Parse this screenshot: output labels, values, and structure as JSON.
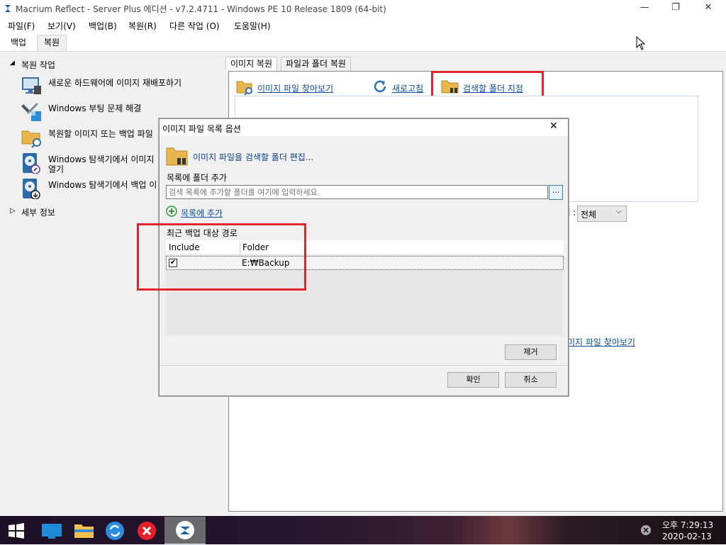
{
  "window": {
    "title": "Macrium Reflect - Server Plus 에디션 - v7.2.4711 - Windows PE 10 Release 1809 (64-bit)",
    "minimize_glyph": "—",
    "maximize_glyph": "❐",
    "close_glyph": "✕"
  },
  "menu": [
    "파일(F)",
    "보기(V)",
    "백업(B)",
    "복원(R)",
    "다른 작업 (O)",
    "도움말(H)"
  ],
  "ribbon_tabs": [
    {
      "label": "백업",
      "active": false
    },
    {
      "label": "복원",
      "active": true
    }
  ],
  "left_pane": {
    "section_title": "복원 작업",
    "items": [
      {
        "label": "새로운 하드웨어에 이미지 재배포하기",
        "icon": "monitor-icon"
      },
      {
        "label": "Windows 부팅 문제 해결",
        "icon": "tools-icon"
      },
      {
        "label": "복원할 이미지 또는 백업 파일",
        "icon": "folder-search-icon"
      },
      {
        "label": "Windows 탐색기에서 이미지",
        "label2": "열기",
        "icon": "disk-open-icon"
      },
      {
        "label": "Windows 탐색기에서 백업 이",
        "icon": "disk-close-icon"
      }
    ],
    "details_title": "세부 정보"
  },
  "main": {
    "tabs": [
      {
        "label": "이미지 복원",
        "active": true
      },
      {
        "label": "파일과 폴더 복원",
        "active": false
      }
    ],
    "toolbar": {
      "browse_label": "이미지 파일 찾아보기",
      "refresh_label": "새로고침",
      "search_folders_label": "검색할 폴더 지정"
    },
    "filter_label_fragment": "l :",
    "filter_value": "전체",
    "bottom_link": "미지 파일 찾아보기"
  },
  "dialog": {
    "title": "이미지 파일 목록 옵션",
    "header": "이미지 파일을 검색할 폴더 편집...",
    "add_section_title": "목록에 폴더 추가",
    "input_placeholder": "검색 목록에 추가할 폴더를 여기에 입력하세요.",
    "browse_button": "...",
    "add_link": "목록에 추가",
    "recent_title": "최근 백업 대상 경로",
    "columns": [
      "Include",
      "Folder"
    ],
    "rows": [
      {
        "include": true,
        "folder": "E:₩Backup"
      }
    ],
    "remove_button": "제거",
    "ok_button": "확인",
    "cancel_button": "취소"
  },
  "taskbar": {
    "clock_time": "오후 7:29:13",
    "clock_date": "2020-02-13"
  },
  "colors": {
    "link": "#0b4ca0",
    "highlight_box": "#e0262c",
    "folder": "#e8b64c"
  }
}
